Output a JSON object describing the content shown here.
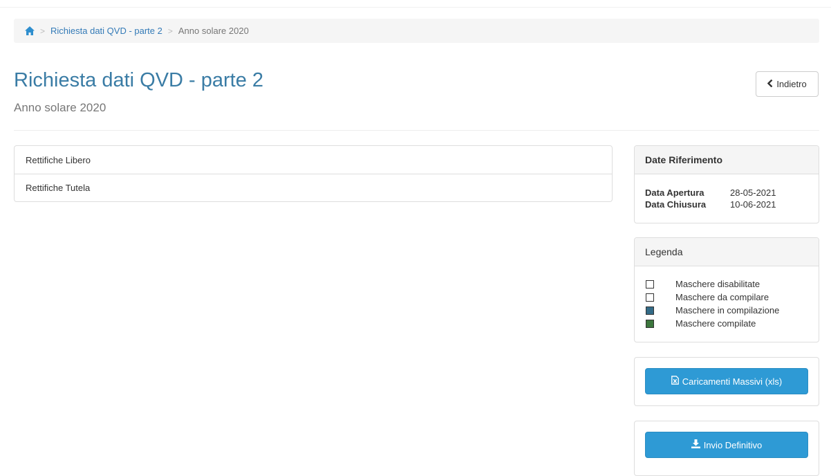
{
  "breadcrumb": {
    "home_icon": "home-icon",
    "separator": ">",
    "link": "Richiesta dati QVD - parte 2",
    "current": "Anno solare 2020"
  },
  "header": {
    "title": "Richiesta dati QVD - parte 2",
    "subtitle": "Anno solare 2020",
    "back_label": "Indietro",
    "back_icon": "chevron-left-icon"
  },
  "masks": [
    {
      "label": "Rettifiche Libero"
    },
    {
      "label": "Rettifiche Tutela"
    }
  ],
  "reference_dates": {
    "title": "Date Riferimento",
    "rows": [
      {
        "label": "Data Apertura",
        "value": "28-05-2021"
      },
      {
        "label": "Data Chiusura",
        "value": "10-06-2021"
      }
    ]
  },
  "legend": {
    "title": "Legenda",
    "items": [
      {
        "label": "Maschere disabilitate",
        "color": "#ffffff"
      },
      {
        "label": "Maschere da compilare",
        "color": "#ffffff"
      },
      {
        "label": "Maschere in compilazione",
        "color": "#336b87"
      },
      {
        "label": "Maschere compilate",
        "color": "#3c763d"
      }
    ]
  },
  "actions": {
    "bulk_upload_label": "Caricamenti Massivi (xls)",
    "bulk_upload_icon": "file-excel-icon",
    "submit_label": "Invio Definitivo",
    "submit_icon": "download-icon"
  },
  "colors": {
    "accent": "#2e9ad5",
    "title": "#3a7ca5"
  }
}
